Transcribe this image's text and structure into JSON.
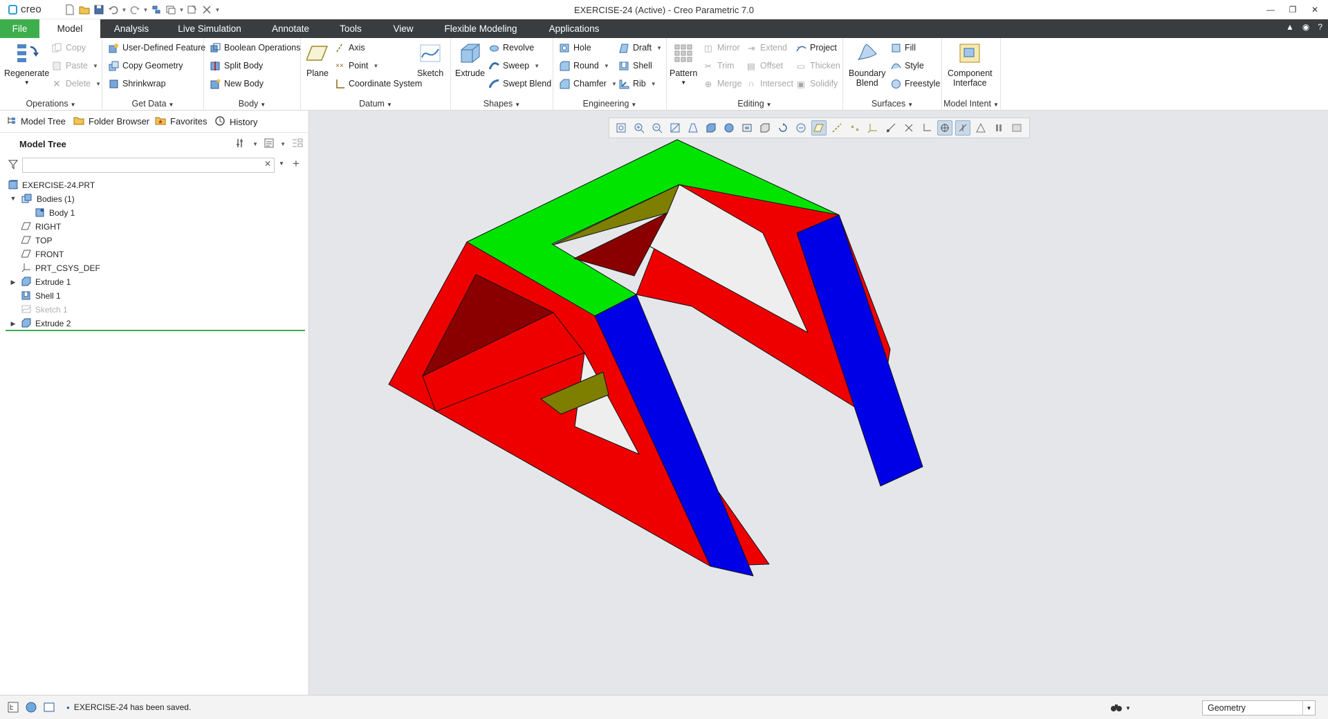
{
  "app": {
    "logo_text": "creo",
    "window_title": "EXERCISE-24 (Active) - Creo Parametric 7.0"
  },
  "tabs": [
    {
      "label": "File"
    },
    {
      "label": "Model"
    },
    {
      "label": "Analysis"
    },
    {
      "label": "Live Simulation"
    },
    {
      "label": "Annotate"
    },
    {
      "label": "Tools"
    },
    {
      "label": "View"
    },
    {
      "label": "Flexible Modeling"
    },
    {
      "label": "Applications"
    }
  ],
  "ribbon": {
    "operations": {
      "label": "Operations",
      "regenerate": "Regenerate",
      "copy": "Copy",
      "paste": "Paste",
      "delete": "Delete"
    },
    "get_data": {
      "label": "Get Data",
      "udf": "User-Defined Feature",
      "copy_geometry": "Copy Geometry",
      "shrinkwrap": "Shrinkwrap"
    },
    "body": {
      "label": "Body",
      "boolean": "Boolean Operations",
      "split": "Split Body",
      "new": "New Body"
    },
    "datum": {
      "label": "Datum",
      "plane": "Plane",
      "axis": "Axis",
      "point": "Point",
      "csys": "Coordinate System",
      "sketch": "Sketch"
    },
    "shapes": {
      "label": "Shapes",
      "extrude": "Extrude",
      "revolve": "Revolve",
      "sweep": "Sweep",
      "swept_blend": "Swept Blend"
    },
    "engineering": {
      "label": "Engineering",
      "hole": "Hole",
      "round": "Round",
      "chamfer": "Chamfer",
      "draft": "Draft",
      "shell": "Shell",
      "rib": "Rib"
    },
    "editing": {
      "label": "Editing",
      "pattern": "Pattern",
      "mirror": "Mirror",
      "trim": "Trim",
      "merge": "Merge",
      "extend": "Extend",
      "offset": "Offset",
      "intersect": "Intersect",
      "project": "Project",
      "thicken": "Thicken",
      "solidify": "Solidify"
    },
    "surfaces": {
      "label": "Surfaces",
      "boundary_blend_1": "Boundary",
      "boundary_blend_2": "Blend",
      "fill": "Fill",
      "style": "Style",
      "freestyle": "Freestyle"
    },
    "model_intent": {
      "label": "Model Intent",
      "component_interface_1": "Component",
      "component_interface_2": "Interface"
    }
  },
  "left_panel": {
    "nav_tabs": [
      "Model Tree",
      "Folder Browser",
      "Favorites",
      "History"
    ],
    "model_tree_title": "Model Tree",
    "search_placeholder": "",
    "tree": [
      {
        "label": "EXERCISE-24.PRT",
        "icon": "part-icon"
      },
      {
        "label": "Bodies (1)",
        "icon": "bodies-icon"
      },
      {
        "label": "Body 1",
        "icon": "body-icon"
      },
      {
        "label": "RIGHT",
        "icon": "datum-plane-icon"
      },
      {
        "label": "TOP",
        "icon": "datum-plane-icon"
      },
      {
        "label": "FRONT",
        "icon": "datum-plane-icon"
      },
      {
        "label": "PRT_CSYS_DEF",
        "icon": "csys-icon"
      },
      {
        "label": "Extrude 1",
        "icon": "extrude-icon"
      },
      {
        "label": "Shell 1",
        "icon": "shell-icon"
      },
      {
        "label": "Sketch 1",
        "icon": "sketch-icon"
      },
      {
        "label": "Extrude 2",
        "icon": "extrude-icon"
      }
    ]
  },
  "status": {
    "message": "EXERCISE-24 has been saved.",
    "filter_value": "Geometry"
  },
  "colors": {
    "accent_green": "#3dae4c",
    "tab_bar": "#3a3d40",
    "face_red": "#ee0000",
    "face_dark_red": "#8a0000",
    "face_green": "#00e400",
    "face_blue": "#0000e6",
    "face_olive": "#7e7e00",
    "viewport_bg": "#e4e6ea"
  }
}
